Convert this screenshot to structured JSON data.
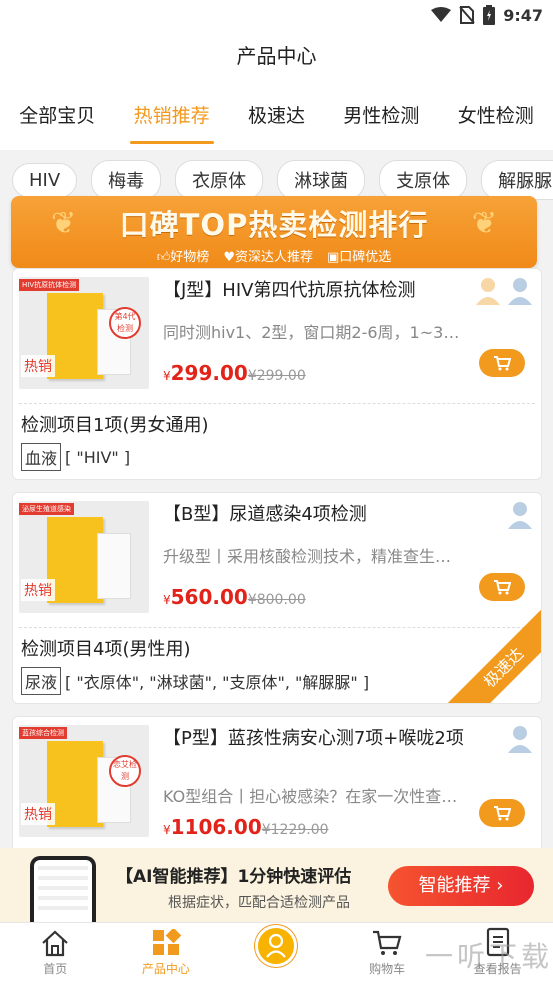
{
  "status_bar": {
    "time": "9:47"
  },
  "header": {
    "title": "产品中心"
  },
  "tabs": [
    {
      "label": "全部宝贝"
    },
    {
      "label": "热销推荐"
    },
    {
      "label": "极速达"
    },
    {
      "label": "男性检测"
    },
    {
      "label": "女性检测"
    }
  ],
  "active_tab": "热销推荐",
  "chips": [
    "HIV",
    "梅毒",
    "衣原体",
    "淋球菌",
    "支原体",
    "解脲脲"
  ],
  "banner": {
    "title": "口碑TOP热卖检测排行",
    "features": [
      "好物榜",
      "资深达人推荐",
      "口碑优选"
    ]
  },
  "products": [
    {
      "title": "【J型】HIV第四代抗原抗体检测",
      "desc": "同时测hiv1、2型，窗口期2-6周，1~3…",
      "currency": "¥",
      "price": "299.00",
      "old_price": "¥299.00",
      "thumb_tag": "HIV抗原抗体检测",
      "thumb_stamp": "第4代检测",
      "hot_label": "热销",
      "items_title": "检测项目1项(男女通用)",
      "sample": "血液",
      "items": "[ \"HIV\" ]",
      "ribbon": ""
    },
    {
      "title": "【B型】尿道感染4项检测",
      "desc": "升级型丨采用核酸检测技术，精准查生…",
      "currency": "¥",
      "price": "560.00",
      "old_price": "¥800.00",
      "thumb_tag": "泌尿生殖道感染",
      "thumb_stamp": "",
      "hot_label": "热销",
      "items_title": "检测项目4项(男性用)",
      "sample": "尿液",
      "items": "[ \"衣原体\", \"淋球菌\", \"支原体\", \"解脲脲\" ]",
      "ribbon": "极速达"
    },
    {
      "title": "【P型】蓝孩性病安心测7项+喉咙2项",
      "desc": "KO型组合丨担心被感染？在家一次性查…",
      "currency": "¥",
      "price": "1106.00",
      "old_price": "¥1229.00",
      "thumb_tag": "蓝孩综合检测",
      "thumb_stamp": "恋艾检测",
      "hot_label": "热销"
    }
  ],
  "promo": {
    "title": "【AI智能推荐】1分钟快速评估",
    "subtitle": "根据症状，匹配合适检测产品",
    "button": "智能推荐"
  },
  "tabbar": [
    {
      "label": "首页"
    },
    {
      "label": "产品中心"
    },
    {
      "label": ""
    },
    {
      "label": "购物车"
    },
    {
      "label": "查看报告"
    }
  ],
  "watermark": "一听下载",
  "colors": {
    "accent": "#f29a1e",
    "price": "#e2231a",
    "promo_button": "#e8262f"
  }
}
